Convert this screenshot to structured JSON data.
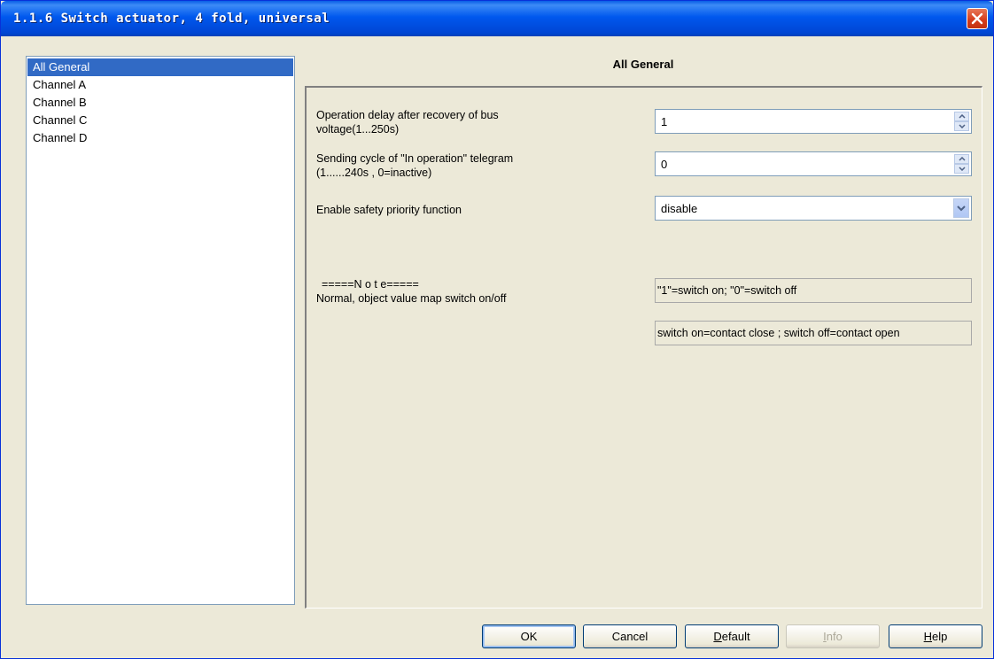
{
  "window": {
    "title": "1.1.6 Switch actuator, 4 fold, universal"
  },
  "sidebar": {
    "items": [
      {
        "label": "All General",
        "selected": true
      },
      {
        "label": "Channel A",
        "selected": false
      },
      {
        "label": "Channel B",
        "selected": false
      },
      {
        "label": "Channel C",
        "selected": false
      },
      {
        "label": "Channel D",
        "selected": false
      }
    ]
  },
  "page": {
    "title": "All General"
  },
  "params": {
    "delay": {
      "label_line1": "Operation delay after recovery of bus",
      "label_line2": "voltage(1...250s)",
      "value": "1"
    },
    "cycle": {
      "label_line1": "Sending cycle of \"In operation\" telegram",
      "label_line2": "(1......240s , 0=inactive)",
      "value": "0"
    },
    "safety": {
      "label": "Enable safety priority function",
      "value": "disable"
    }
  },
  "note": {
    "heading": "=====N o t e=====",
    "text": "Normal, object value map switch on/off",
    "box1": "\"1\"=switch on; \"0\"=switch off",
    "box2": "switch on=contact close ; switch off=contact open"
  },
  "buttons": {
    "ok": "OK",
    "cancel": "Cancel",
    "default_first": "D",
    "default_rest": "efault",
    "info_first": "I",
    "info_rest": "nfo",
    "help_first": "H",
    "help_rest": "elp"
  },
  "colors": {
    "titlebar": "#0058ee",
    "selection": "#316ac5",
    "dialog_bg": "#ece9d8"
  },
  "icons": {
    "close": "close-icon",
    "spin_up": "chevron-up-icon",
    "spin_down": "chevron-down-icon",
    "dropdown": "chevron-down-icon"
  }
}
